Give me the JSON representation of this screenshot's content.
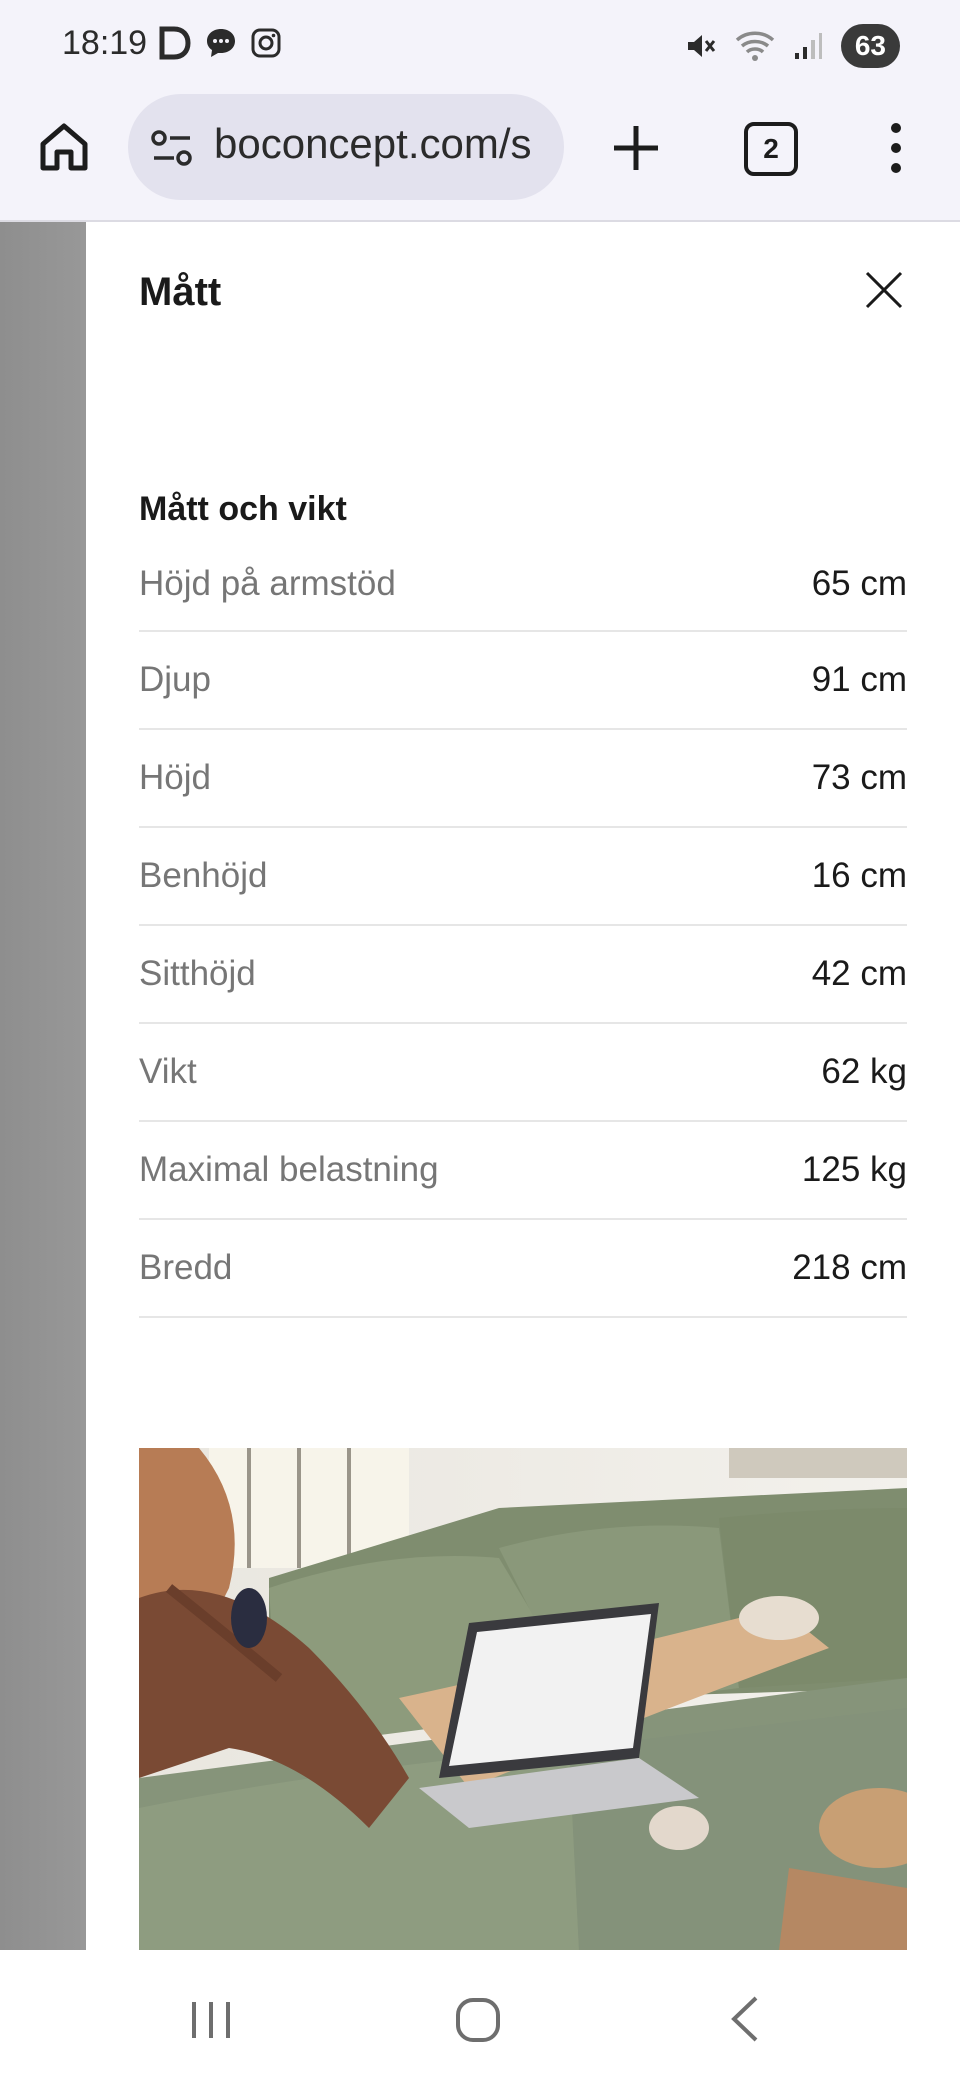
{
  "status_bar": {
    "time": "18:19",
    "left_icons": [
      "d-app-icon",
      "chat-bubble-icon",
      "instagram-icon"
    ],
    "right_icons": [
      "mute-icon",
      "wifi-icon",
      "signal-icon"
    ],
    "battery": "63"
  },
  "browser": {
    "url": "boconcept.com/s",
    "tab_count": "2",
    "icons": [
      "home-icon",
      "site-settings-icon",
      "plus-icon",
      "tab-switcher-icon",
      "more-vert-icon"
    ]
  },
  "panel": {
    "title": "Mått",
    "section_heading": "Mått och vikt",
    "specs": [
      {
        "label": "Höjd på armstöd",
        "value": "65 cm"
      },
      {
        "label": "Djup",
        "value": "91 cm"
      },
      {
        "label": "Höjd",
        "value": "73 cm"
      },
      {
        "label": "Benhöjd",
        "value": "16 cm"
      },
      {
        "label": "Sitthöjd",
        "value": "42 cm"
      },
      {
        "label": "Vikt",
        "value": "62 kg"
      },
      {
        "label": "Maximal belastning",
        "value": "125 kg"
      },
      {
        "label": "Bredd",
        "value": "218 cm"
      }
    ]
  },
  "colors": {
    "sofa": "#8a9a7a",
    "panel_bg": "#ffffff",
    "overlay": "#8e8e8e"
  },
  "nav": {
    "icons": [
      "recents-icon",
      "home-circle-icon",
      "back-icon"
    ]
  }
}
